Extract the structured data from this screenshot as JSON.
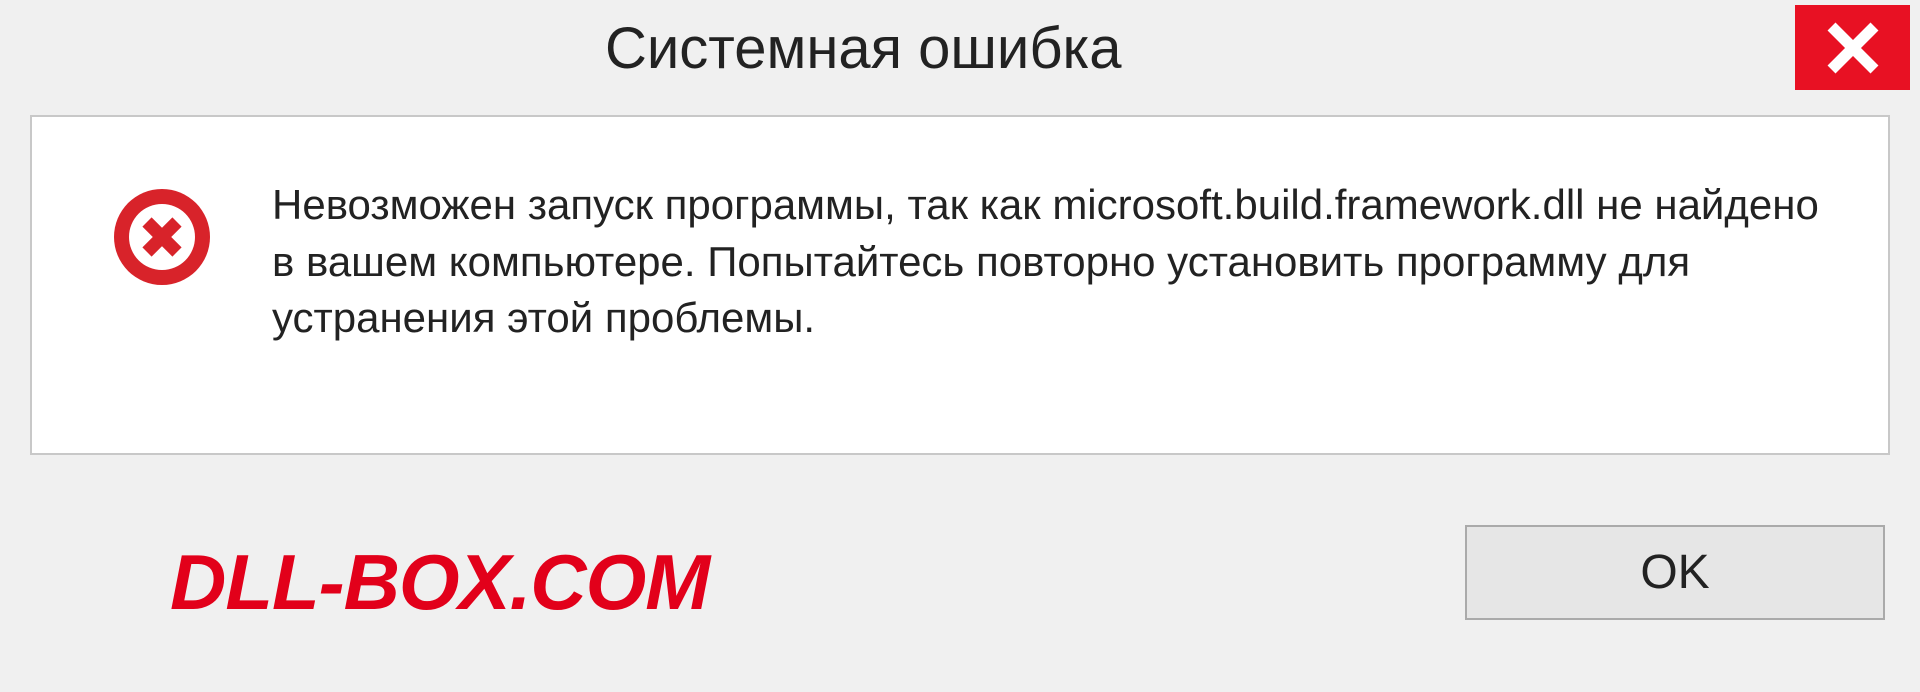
{
  "dialog": {
    "title": "Системная ошибка",
    "message": "Невозможен запуск программы, так как microsoft.build.framework.dll  не найдено в вашем компьютере. Попытайтесь повторно установить программу для устранения этой проблемы.",
    "ok_label": "OK"
  },
  "watermark": "DLL-BOX.COM",
  "colors": {
    "close_bg": "#e81123",
    "error_icon": "#d8232a",
    "watermark": "#e2001a"
  }
}
